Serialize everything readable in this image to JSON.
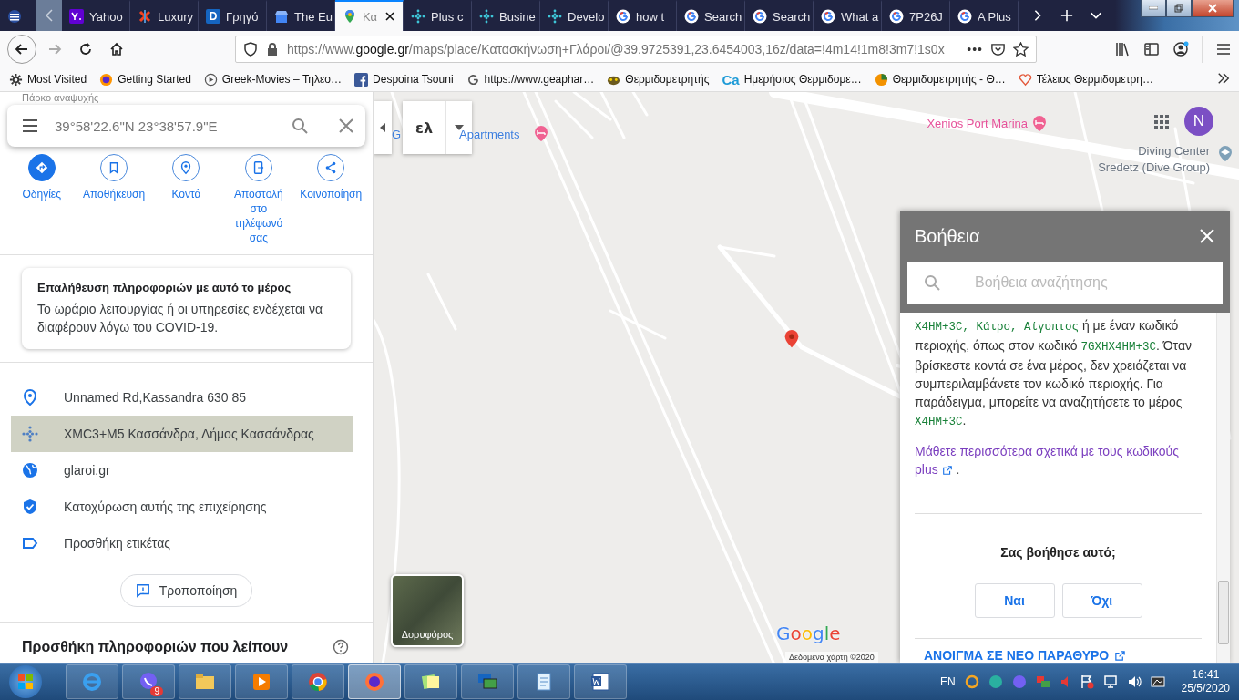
{
  "browser": {
    "tabs": [
      {
        "kind": "flag",
        "selected": false
      },
      {
        "title": "Yahoo",
        "kind": "yahoo",
        "selected": false
      },
      {
        "title": "Luxury",
        "kind": "puzzle",
        "selected": false
      },
      {
        "title": "Γρηγό",
        "kind": "letter",
        "selected": false
      },
      {
        "title": "The Eu",
        "kind": "store",
        "selected": false
      },
      {
        "title": "Κα",
        "kind": "pin",
        "selected": true
      },
      {
        "title": "Plus c",
        "kind": "dots",
        "selected": false
      },
      {
        "title": "Busine",
        "kind": "dots",
        "selected": false
      },
      {
        "title": "Develo",
        "kind": "dots",
        "selected": false
      },
      {
        "title": "how t",
        "kind": "google",
        "selected": false
      },
      {
        "title": "Search",
        "kind": "google",
        "selected": false
      },
      {
        "title": "Search",
        "kind": "google",
        "selected": false
      },
      {
        "title": "What a",
        "kind": "google",
        "selected": false
      },
      {
        "title": "7P26J",
        "kind": "google",
        "selected": false
      },
      {
        "title": "A Plus",
        "kind": "google",
        "selected": false
      }
    ],
    "letter_tab_glyph": "D",
    "address": {
      "scheme": "https://www.",
      "domain": "google.gr",
      "path": "/maps/place/Κατασκήνωση+Γλάροι/@39.9725391,23.6454003,16z/data=!4m14!1m8!3m7!1s0x"
    },
    "more_actions": "•••",
    "bookmarks": [
      {
        "label": "Most Visited",
        "kind": "gear"
      },
      {
        "label": "Getting Started",
        "kind": "firefox"
      },
      {
        "label": "Greek-Movies – Τηλεο…",
        "kind": "play"
      },
      {
        "label": "Despoina Tsouni",
        "kind": "facebook"
      },
      {
        "label": "https://www.geaphar…",
        "kind": "g"
      },
      {
        "label": "Θερμιδομετρητής",
        "kind": "bug"
      },
      {
        "label": "Ημερήσιος Θερμιδομε…",
        "kind": "ca"
      },
      {
        "label": "Θερμιδομετρητής - Θ…",
        "kind": "pie"
      },
      {
        "label": "Τέλειος Θερμιδομετρη…",
        "kind": "heart"
      }
    ],
    "bookmark_ca_glyph": "Ca"
  },
  "place_panel": {
    "subtitle": "Πάρκο αναψυχής",
    "search": {
      "value": "39°58'22.6\"N 23°38'57.9\"E"
    },
    "actions": [
      {
        "label": "Οδηγίες",
        "kind": "primary"
      },
      {
        "label": "Αποθήκευση",
        "kind": "outline"
      },
      {
        "label": "Κοντά",
        "kind": "outline"
      },
      {
        "label": "Αποστολή στο τηλέφωνό σας",
        "kind": "outline"
      },
      {
        "label": "Κοινοποίηση",
        "kind": "outline"
      }
    ],
    "notice": {
      "title": "Επαλήθευση πληροφοριών με αυτό το μέρος",
      "body": "Το ωράριο λειτουργίας ή οι υπηρεσίες ενδέχεται να διαφέρουν λόγω του COVID-19."
    },
    "info_rows": [
      {
        "text": "Unnamed Rd,Kassandra 630 85",
        "kind": "address",
        "selected": false
      },
      {
        "text": "XMC3+M5 Κασσάνδρα, Δήμος Κασσάνδρας",
        "kind": "plus_code",
        "selected": true
      },
      {
        "text": "glaroi.gr",
        "kind": "website",
        "selected": false
      },
      {
        "text": "Κατοχύρωση αυτής της επιχείρησης",
        "kind": "claim",
        "selected": false
      },
      {
        "text": "Προσθήκη ετικέτας",
        "kind": "label",
        "selected": false
      }
    ],
    "edit_button": "Τροποποίηση",
    "footer": "Προσθήκη πληροφοριών που λείπουν"
  },
  "map": {
    "language": "ελ",
    "labels": [
      {
        "text": "G",
        "kind": "blue"
      },
      {
        "text": "Apartments",
        "kind": "blue"
      },
      {
        "text": "Xenios Port Marina",
        "kind": "pink"
      },
      {
        "text": "Diving Center\nSredetz (Dive Group)",
        "kind": "grey"
      }
    ],
    "avatar": "N",
    "satellite": "Δορυφόρος",
    "logo": "Google",
    "copyright": "Δεδομένα χάρτη ©2020"
  },
  "help": {
    "title": "Βοήθεια",
    "search": {
      "placeholder": "Βοήθεια αναζήτησης"
    },
    "paragraph": [
      {
        "text": "X4HM+3C, Κάιρο, Αίγυπτος",
        "kind": "code"
      },
      {
        "text": " ή με έναν κωδικό περιοχής, όπως στον κωδικό ",
        "kind": "text"
      },
      {
        "text": "7GXHX4HM+3C",
        "kind": "code"
      },
      {
        "text": ". Όταν βρίσκεστε κοντά σε ένα μέρος, δεν χρειάζεται να συμπεριλαμβάνετε τον κωδικό περιοχής. Για παράδειγμα, μπορείτε να αναζητήσετε το μέρος ",
        "kind": "text"
      },
      {
        "text": "X4HM+3C",
        "kind": "code"
      },
      {
        "text": ".",
        "kind": "text"
      }
    ],
    "learn_more": "Μάθετε περισσότερα σχετικά με τους κωδικούς plus",
    "learn_more_tail": ".",
    "question": "Σας βοήθησε αυτό;",
    "answers": [
      "Ναι",
      "Όχι"
    ],
    "open_new": "ΑΝΟΙΓΜΑ ΣΕ ΝΕΟ ΠΑΡΑΘΥΡΟ"
  },
  "taskbar": {
    "apps": [
      {
        "kind": "ie",
        "active": false
      },
      {
        "kind": "viber",
        "active": false,
        "badge": "9"
      },
      {
        "kind": "folder",
        "active": false
      },
      {
        "kind": "media",
        "active": false
      },
      {
        "kind": "chrome",
        "active": false
      },
      {
        "kind": "firefox",
        "active": true
      },
      {
        "kind": "notes",
        "active": false
      },
      {
        "kind": "network",
        "active": false
      },
      {
        "kind": "notepad",
        "active": false
      },
      {
        "kind": "word",
        "active": false
      }
    ],
    "language": "EN",
    "time": "16:41",
    "date": "25/5/2020"
  }
}
